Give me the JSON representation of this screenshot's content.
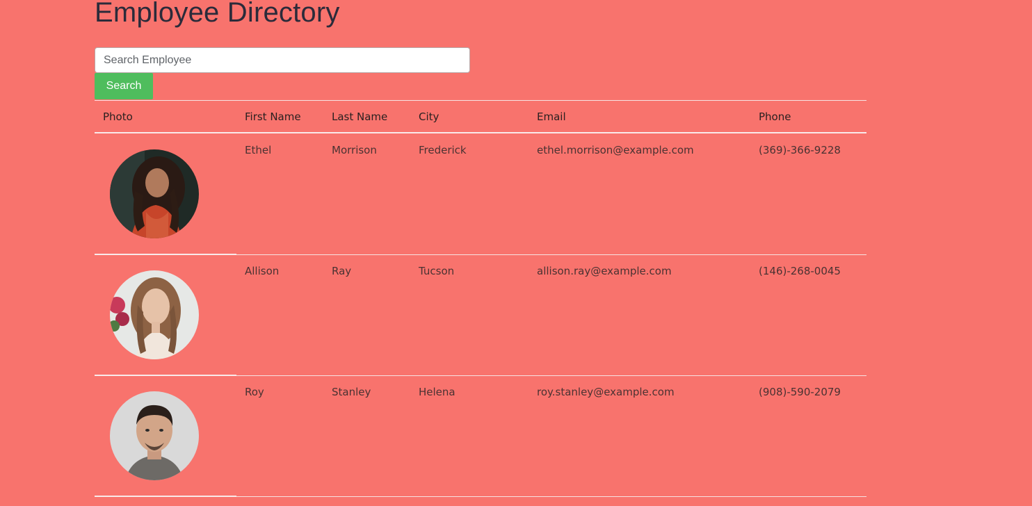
{
  "page": {
    "title": "Employee Directory",
    "background": "#f8736d"
  },
  "search": {
    "placeholder": "Search Employee",
    "value": "",
    "button_label": "Search",
    "button_color": "#4fbd5d"
  },
  "table": {
    "headers": {
      "photo": "Photo",
      "first_name": "First Name",
      "last_name": "Last Name",
      "city": "City",
      "email": "Email",
      "phone": "Phone"
    },
    "rows": [
      {
        "photo_icon": "avatar-woman-dark-hair-photo",
        "first_name": "Ethel",
        "last_name": "Morrison",
        "city": "Frederick",
        "email": "ethel.morrison@example.com",
        "phone": "(369)-366-9228"
      },
      {
        "photo_icon": "avatar-woman-light-hair-photo",
        "first_name": "Allison",
        "last_name": "Ray",
        "city": "Tucson",
        "email": "allison.ray@example.com",
        "phone": "(146)-268-0045"
      },
      {
        "photo_icon": "avatar-man-dark-hair-photo",
        "first_name": "Roy",
        "last_name": "Stanley",
        "city": "Helena",
        "email": "roy.stanley@example.com",
        "phone": "(908)-590-2079"
      }
    ]
  }
}
